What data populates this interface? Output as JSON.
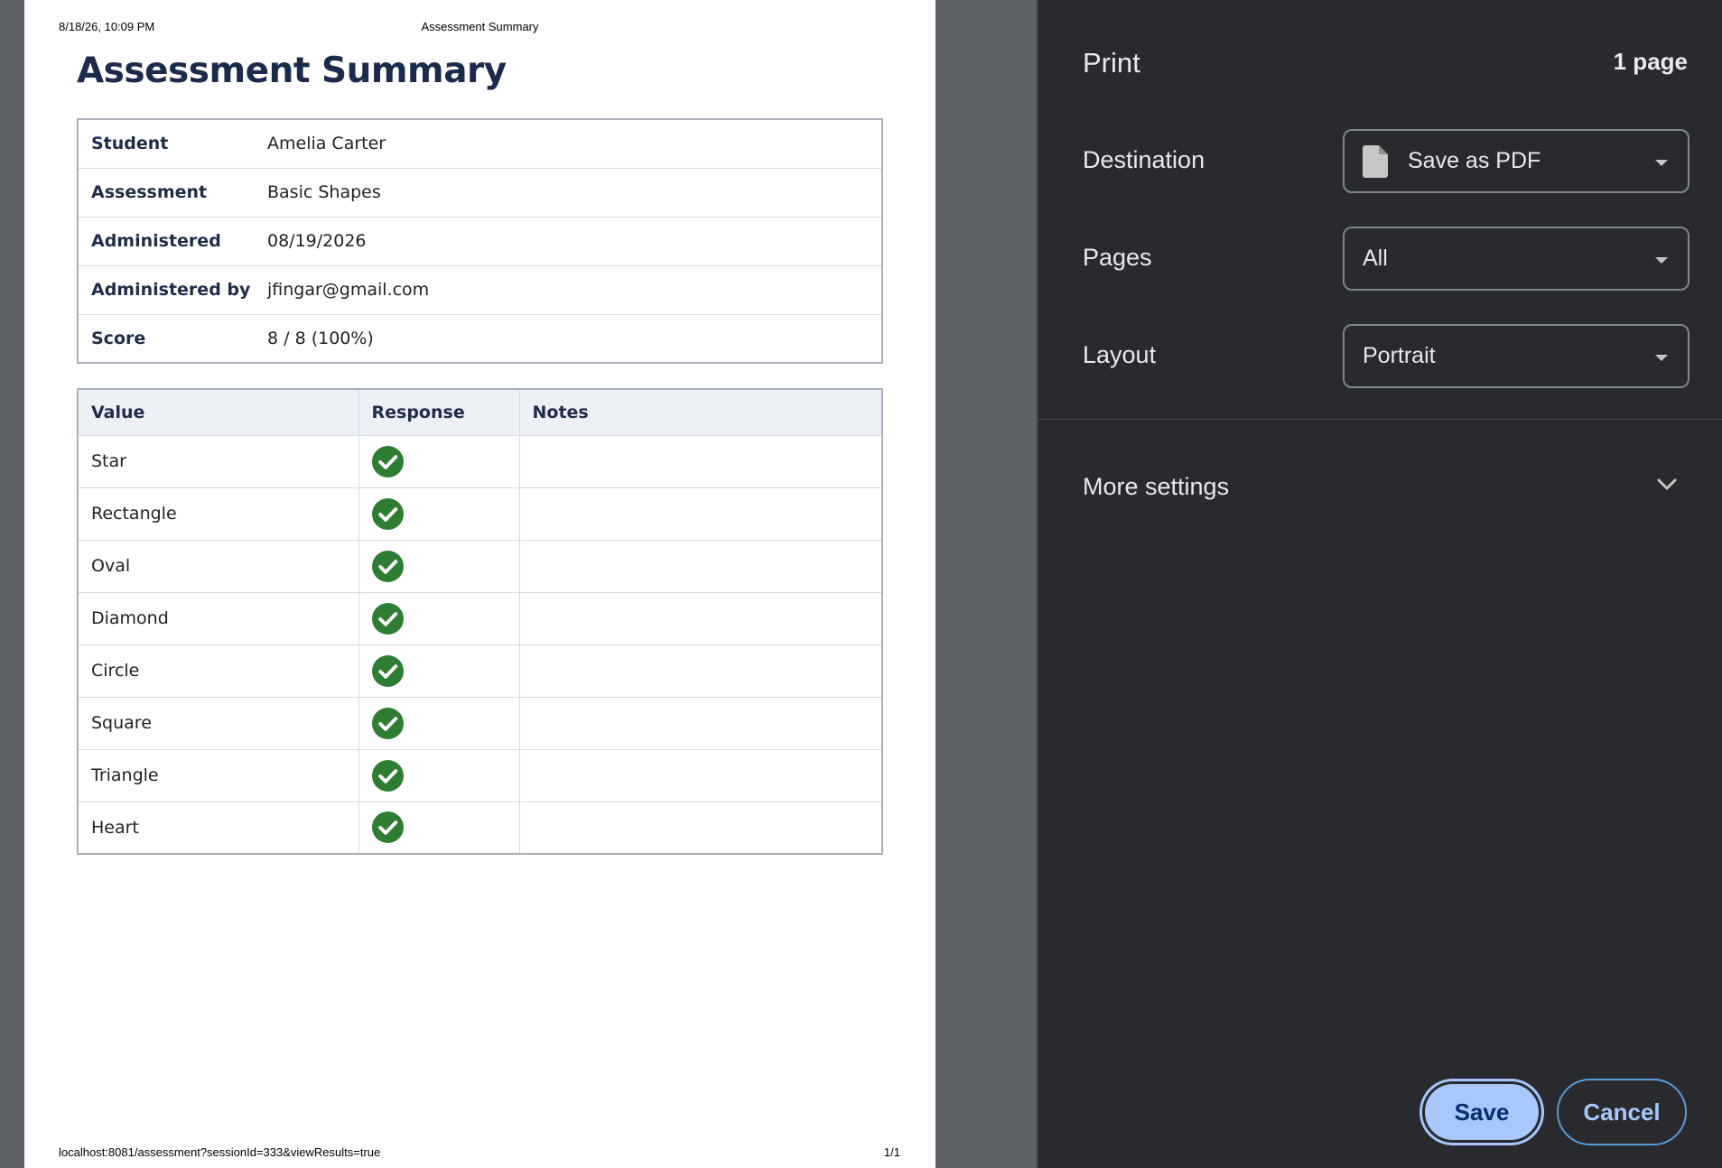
{
  "page_header": {
    "date": "8/18/26, 10:09 PM",
    "title": "Assessment Summary"
  },
  "page_footer": {
    "url": "localhost:8081/assessment?sessionId=333&viewResults=true",
    "page_number": "1/1"
  },
  "document": {
    "title": "Assessment Summary",
    "info": [
      {
        "label": "Student",
        "value": "Amelia Carter"
      },
      {
        "label": "Assessment",
        "value": "Basic Shapes"
      },
      {
        "label": "Administered",
        "value": "08/19/2026"
      },
      {
        "label": "Administered by",
        "value": "jfingar@gmail.com"
      },
      {
        "label": "Score",
        "value": "8 / 8 (100%)"
      }
    ],
    "responses_table": {
      "headers": [
        "Value",
        "Response",
        "Notes"
      ],
      "rows": [
        {
          "value": "Star",
          "response": "correct-check-icon",
          "notes": ""
        },
        {
          "value": "Rectangle",
          "response": "correct-check-icon",
          "notes": ""
        },
        {
          "value": "Oval",
          "response": "correct-check-icon",
          "notes": ""
        },
        {
          "value": "Diamond",
          "response": "correct-check-icon",
          "notes": ""
        },
        {
          "value": "Circle",
          "response": "correct-check-icon",
          "notes": ""
        },
        {
          "value": "Square",
          "response": "correct-check-icon",
          "notes": ""
        },
        {
          "value": "Triangle",
          "response": "correct-check-icon",
          "notes": ""
        },
        {
          "value": "Heart",
          "response": "correct-check-icon",
          "notes": ""
        }
      ]
    }
  },
  "print_panel": {
    "title": "Print",
    "page_count": "1 page",
    "destination": {
      "label": "Destination",
      "value": "Save as PDF",
      "icon": "document-icon"
    },
    "pages": {
      "label": "Pages",
      "value": "All"
    },
    "layout": {
      "label": "Layout",
      "value": "Portrait"
    },
    "more_settings": "More settings",
    "save_label": "Save",
    "cancel_label": "Cancel"
  },
  "colors": {
    "check_green": "#2e7d32",
    "panel_bg": "#292a2d",
    "save_button_bg": "#a8c7fa",
    "title_navy": "#1c2b4a"
  }
}
